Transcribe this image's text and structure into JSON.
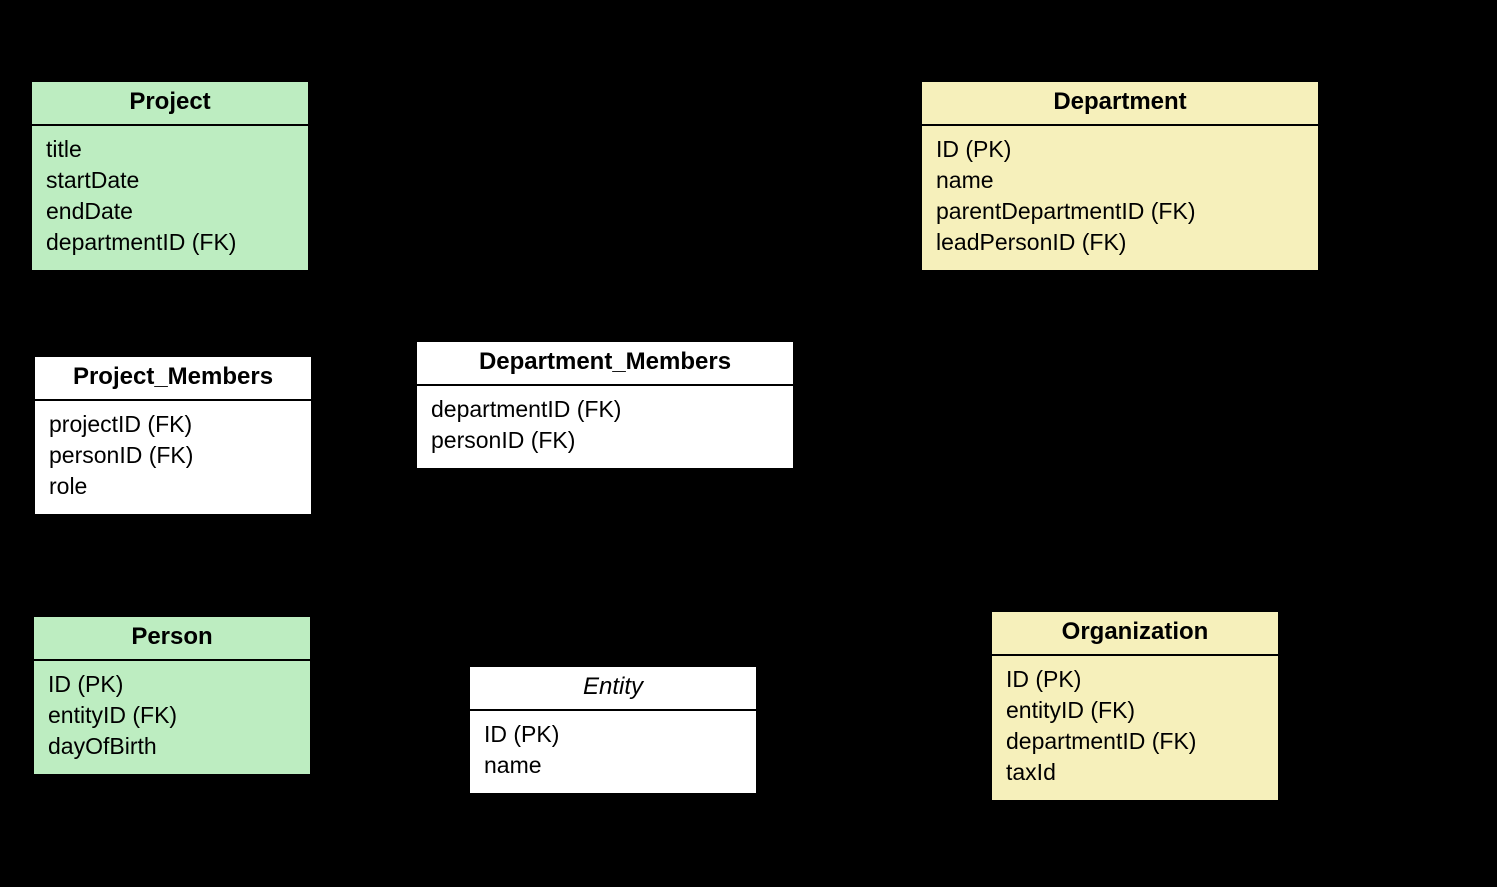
{
  "entities": {
    "project": {
      "title": "Project",
      "attrs": [
        "title",
        "startDate",
        "endDate",
        "departmentID (FK)"
      ]
    },
    "department": {
      "title": "Department",
      "attrs": [
        "ID (PK)",
        "name",
        "parentDepartmentID (FK)",
        "leadPersonID (FK)"
      ]
    },
    "projectMembers": {
      "title": "Project_Members",
      "attrs": [
        "projectID (FK)",
        "personID (FK)",
        "role"
      ]
    },
    "departmentMembers": {
      "title": "Department_Members",
      "attrs": [
        "departmentID (FK)",
        "personID (FK)"
      ]
    },
    "person": {
      "title": "Person",
      "attrs": [
        "ID (PK)",
        "entityID (FK)",
        "dayOfBirth"
      ]
    },
    "entity": {
      "title": "Entity",
      "attrs": [
        "ID (PK)",
        "name"
      ]
    },
    "organization": {
      "title": "Organization",
      "attrs": [
        "ID (PK)",
        "entityID (FK)",
        "departmentID (FK)",
        "taxId"
      ]
    }
  }
}
